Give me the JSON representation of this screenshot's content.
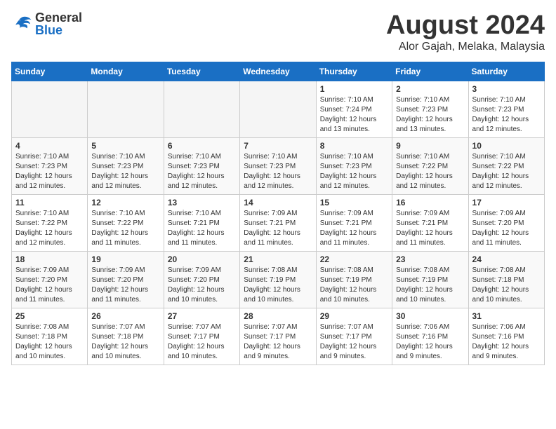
{
  "header": {
    "logo_general": "General",
    "logo_blue": "Blue",
    "title": "August 2024",
    "subtitle": "Alor Gajah, Melaka, Malaysia"
  },
  "days_of_week": [
    "Sunday",
    "Monday",
    "Tuesday",
    "Wednesday",
    "Thursday",
    "Friday",
    "Saturday"
  ],
  "weeks": [
    [
      {
        "day": "",
        "info": ""
      },
      {
        "day": "",
        "info": ""
      },
      {
        "day": "",
        "info": ""
      },
      {
        "day": "",
        "info": ""
      },
      {
        "day": "1",
        "info": "Sunrise: 7:10 AM\nSunset: 7:24 PM\nDaylight: 12 hours\nand 13 minutes."
      },
      {
        "day": "2",
        "info": "Sunrise: 7:10 AM\nSunset: 7:23 PM\nDaylight: 12 hours\nand 13 minutes."
      },
      {
        "day": "3",
        "info": "Sunrise: 7:10 AM\nSunset: 7:23 PM\nDaylight: 12 hours\nand 12 minutes."
      }
    ],
    [
      {
        "day": "4",
        "info": "Sunrise: 7:10 AM\nSunset: 7:23 PM\nDaylight: 12 hours\nand 12 minutes."
      },
      {
        "day": "5",
        "info": "Sunrise: 7:10 AM\nSunset: 7:23 PM\nDaylight: 12 hours\nand 12 minutes."
      },
      {
        "day": "6",
        "info": "Sunrise: 7:10 AM\nSunset: 7:23 PM\nDaylight: 12 hours\nand 12 minutes."
      },
      {
        "day": "7",
        "info": "Sunrise: 7:10 AM\nSunset: 7:23 PM\nDaylight: 12 hours\nand 12 minutes."
      },
      {
        "day": "8",
        "info": "Sunrise: 7:10 AM\nSunset: 7:23 PM\nDaylight: 12 hours\nand 12 minutes."
      },
      {
        "day": "9",
        "info": "Sunrise: 7:10 AM\nSunset: 7:22 PM\nDaylight: 12 hours\nand 12 minutes."
      },
      {
        "day": "10",
        "info": "Sunrise: 7:10 AM\nSunset: 7:22 PM\nDaylight: 12 hours\nand 12 minutes."
      }
    ],
    [
      {
        "day": "11",
        "info": "Sunrise: 7:10 AM\nSunset: 7:22 PM\nDaylight: 12 hours\nand 12 minutes."
      },
      {
        "day": "12",
        "info": "Sunrise: 7:10 AM\nSunset: 7:22 PM\nDaylight: 12 hours\nand 11 minutes."
      },
      {
        "day": "13",
        "info": "Sunrise: 7:10 AM\nSunset: 7:21 PM\nDaylight: 12 hours\nand 11 minutes."
      },
      {
        "day": "14",
        "info": "Sunrise: 7:09 AM\nSunset: 7:21 PM\nDaylight: 12 hours\nand 11 minutes."
      },
      {
        "day": "15",
        "info": "Sunrise: 7:09 AM\nSunset: 7:21 PM\nDaylight: 12 hours\nand 11 minutes."
      },
      {
        "day": "16",
        "info": "Sunrise: 7:09 AM\nSunset: 7:21 PM\nDaylight: 12 hours\nand 11 minutes."
      },
      {
        "day": "17",
        "info": "Sunrise: 7:09 AM\nSunset: 7:20 PM\nDaylight: 12 hours\nand 11 minutes."
      }
    ],
    [
      {
        "day": "18",
        "info": "Sunrise: 7:09 AM\nSunset: 7:20 PM\nDaylight: 12 hours\nand 11 minutes."
      },
      {
        "day": "19",
        "info": "Sunrise: 7:09 AM\nSunset: 7:20 PM\nDaylight: 12 hours\nand 11 minutes."
      },
      {
        "day": "20",
        "info": "Sunrise: 7:09 AM\nSunset: 7:20 PM\nDaylight: 12 hours\nand 10 minutes."
      },
      {
        "day": "21",
        "info": "Sunrise: 7:08 AM\nSunset: 7:19 PM\nDaylight: 12 hours\nand 10 minutes."
      },
      {
        "day": "22",
        "info": "Sunrise: 7:08 AM\nSunset: 7:19 PM\nDaylight: 12 hours\nand 10 minutes."
      },
      {
        "day": "23",
        "info": "Sunrise: 7:08 AM\nSunset: 7:19 PM\nDaylight: 12 hours\nand 10 minutes."
      },
      {
        "day": "24",
        "info": "Sunrise: 7:08 AM\nSunset: 7:18 PM\nDaylight: 12 hours\nand 10 minutes."
      }
    ],
    [
      {
        "day": "25",
        "info": "Sunrise: 7:08 AM\nSunset: 7:18 PM\nDaylight: 12 hours\nand 10 minutes."
      },
      {
        "day": "26",
        "info": "Sunrise: 7:07 AM\nSunset: 7:18 PM\nDaylight: 12 hours\nand 10 minutes."
      },
      {
        "day": "27",
        "info": "Sunrise: 7:07 AM\nSunset: 7:17 PM\nDaylight: 12 hours\nand 10 minutes."
      },
      {
        "day": "28",
        "info": "Sunrise: 7:07 AM\nSunset: 7:17 PM\nDaylight: 12 hours\nand 9 minutes."
      },
      {
        "day": "29",
        "info": "Sunrise: 7:07 AM\nSunset: 7:17 PM\nDaylight: 12 hours\nand 9 minutes."
      },
      {
        "day": "30",
        "info": "Sunrise: 7:06 AM\nSunset: 7:16 PM\nDaylight: 12 hours\nand 9 minutes."
      },
      {
        "day": "31",
        "info": "Sunrise: 7:06 AM\nSunset: 7:16 PM\nDaylight: 12 hours\nand 9 minutes."
      }
    ]
  ]
}
